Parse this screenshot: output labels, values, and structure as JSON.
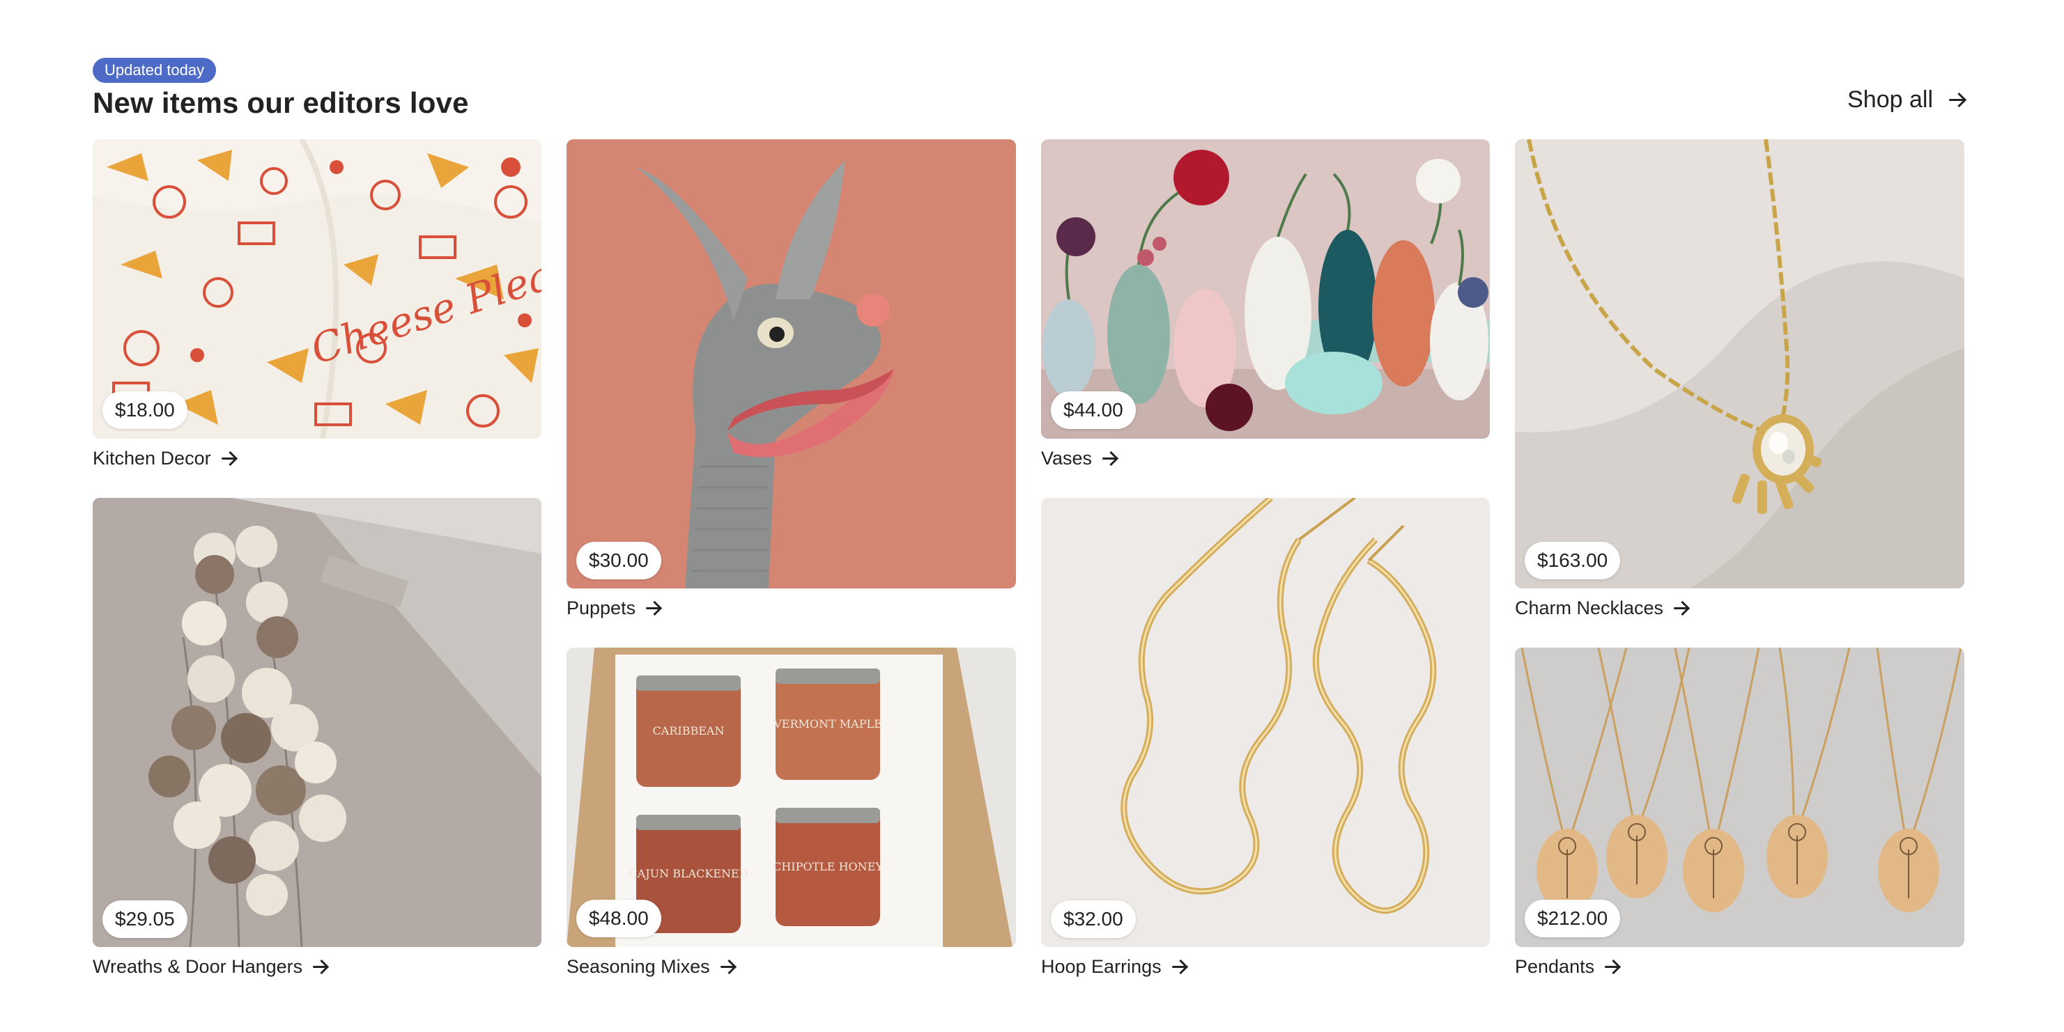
{
  "section": {
    "badge": "Updated today",
    "heading": "New items our editors love",
    "shop_all": "Shop all"
  },
  "items": [
    {
      "price": "$18.00",
      "label": "Kitchen Decor",
      "image": "cheese-please-tea-towel"
    },
    {
      "price": "$30.00",
      "label": "Puppets",
      "image": "grey-sock-dog-puppet"
    },
    {
      "price": "$44.00",
      "label": "Vases",
      "image": "ceramic-bud-vases"
    },
    {
      "price": "$163.00",
      "label": "Charm Necklaces",
      "image": "gold-opal-sun-necklace"
    },
    {
      "price": "$29.05",
      "label": "Wreaths & Door Hangers",
      "image": "felt-acorn-garland"
    },
    {
      "price": "$48.00",
      "label": "Seasoning Mixes",
      "image": "seasoning-jar-gift-box"
    },
    {
      "price": "$32.00",
      "label": "Hoop Earrings",
      "image": "gold-wavy-hoop-earrings"
    },
    {
      "price": "$212.00",
      "label": "Pendants",
      "image": "engraved-flower-pendants"
    }
  ],
  "jar_labels": [
    "CARIBBEAN",
    "VERMONT MAPLE",
    "CAJUN BLACKENED",
    "CHIPOTLE HONEY"
  ],
  "towel_text": "Cheese Please",
  "colors": {
    "badge": "#4d6bc6",
    "text": "#222222",
    "background": "#ffffff"
  }
}
